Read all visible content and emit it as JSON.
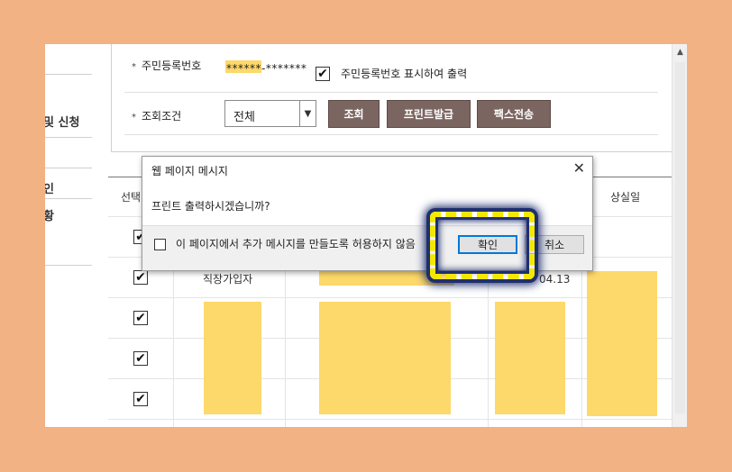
{
  "sidebar": {
    "items": [
      {
        "label": "및 신청"
      },
      {
        "label": "인"
      },
      {
        "label": "황"
      }
    ]
  },
  "form": {
    "resident_number": {
      "label": "주민등록번호",
      "masked_value": "******-*******",
      "print_checkbox_label": "주민등록번호 표시하여 출력",
      "print_checked": true
    },
    "query_condition": {
      "label": "조회조건",
      "selected": "전체"
    },
    "buttons": {
      "search": "조회",
      "print": "프린트발급",
      "fax": "팩스전송"
    },
    "required_mark": "*"
  },
  "table": {
    "headers": {
      "select": "선택",
      "loss_date": "상실일"
    },
    "rows": [
      {
        "checked": true
      },
      {
        "checked": true,
        "type": "직장가입자",
        "date": "04.13"
      },
      {
        "checked": true
      },
      {
        "checked": true
      },
      {
        "checked": true
      }
    ]
  },
  "dialog": {
    "title": "웹 페이지 메시지",
    "close": "✕",
    "message": "프린트 출력하시겠습니까?",
    "suppress_label": "이 페이지에서 추가 메시지를 만들도록 허용하지 않음",
    "ok_label": "확인",
    "cancel_label": "취소"
  },
  "colors": {
    "background": "#f2b283",
    "button": "#7b6560",
    "redaction": "#fdd86a",
    "highlight": "#f3e800"
  }
}
